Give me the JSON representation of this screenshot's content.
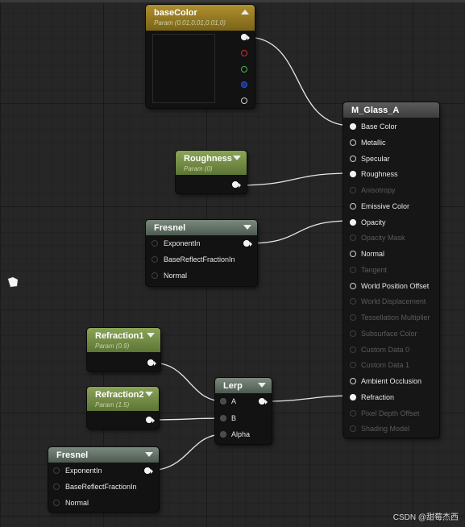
{
  "nodes": {
    "basecolor": {
      "title": "baseColor",
      "subtitle": "Param (0.01,0.01,0.01,0)"
    },
    "roughness": {
      "title": "Roughness",
      "subtitle": "Param (0)"
    },
    "fresnel1": {
      "title": "Fresnel",
      "inputs": [
        "ExponentIn",
        "BaseReflectFractionIn",
        "Normal"
      ]
    },
    "refraction1": {
      "title": "Refraction1",
      "subtitle": "Param (0.9)"
    },
    "refraction2": {
      "title": "Refraction2",
      "subtitle": "Param (1.5)"
    },
    "lerp": {
      "title": "Lerp",
      "inputs": [
        "A",
        "B",
        "Alpha"
      ]
    },
    "fresnel2": {
      "title": "Fresnel",
      "inputs": [
        "ExponentIn",
        "BaseReflectFractionIn",
        "Normal"
      ]
    },
    "material": {
      "title": "M_Glass_A",
      "inputs": [
        {
          "label": "Base Color",
          "state": "connected"
        },
        {
          "label": "Metallic",
          "state": "active"
        },
        {
          "label": "Specular",
          "state": "active"
        },
        {
          "label": "Roughness",
          "state": "connected"
        },
        {
          "label": "Anisotropy",
          "state": "disabled"
        },
        {
          "label": "Emissive Color",
          "state": "active"
        },
        {
          "label": "Opacity",
          "state": "connected"
        },
        {
          "label": "Opacity Mask",
          "state": "disabled"
        },
        {
          "label": "Normal",
          "state": "active"
        },
        {
          "label": "Tangent",
          "state": "disabled"
        },
        {
          "label": "World Position Offset",
          "state": "active"
        },
        {
          "label": "World Displacement",
          "state": "disabled"
        },
        {
          "label": "Tessellation Multiplier",
          "state": "disabled"
        },
        {
          "label": "Subsurface Color",
          "state": "disabled"
        },
        {
          "label": "Custom Data 0",
          "state": "disabled"
        },
        {
          "label": "Custom Data 1",
          "state": "disabled"
        },
        {
          "label": "Ambient Occlusion",
          "state": "active"
        },
        {
          "label": "Refraction",
          "state": "connected"
        },
        {
          "label": "Pixel Depth Offset",
          "state": "disabled"
        },
        {
          "label": "Shading Model",
          "state": "disabled"
        }
      ]
    }
  },
  "watermark": "CSDN @甜莓杰西",
  "colors": {
    "header_green": "#7a9347",
    "header_gray": "#6a786d",
    "header_gold": "#a08426",
    "wire": "#e8e8e8"
  }
}
